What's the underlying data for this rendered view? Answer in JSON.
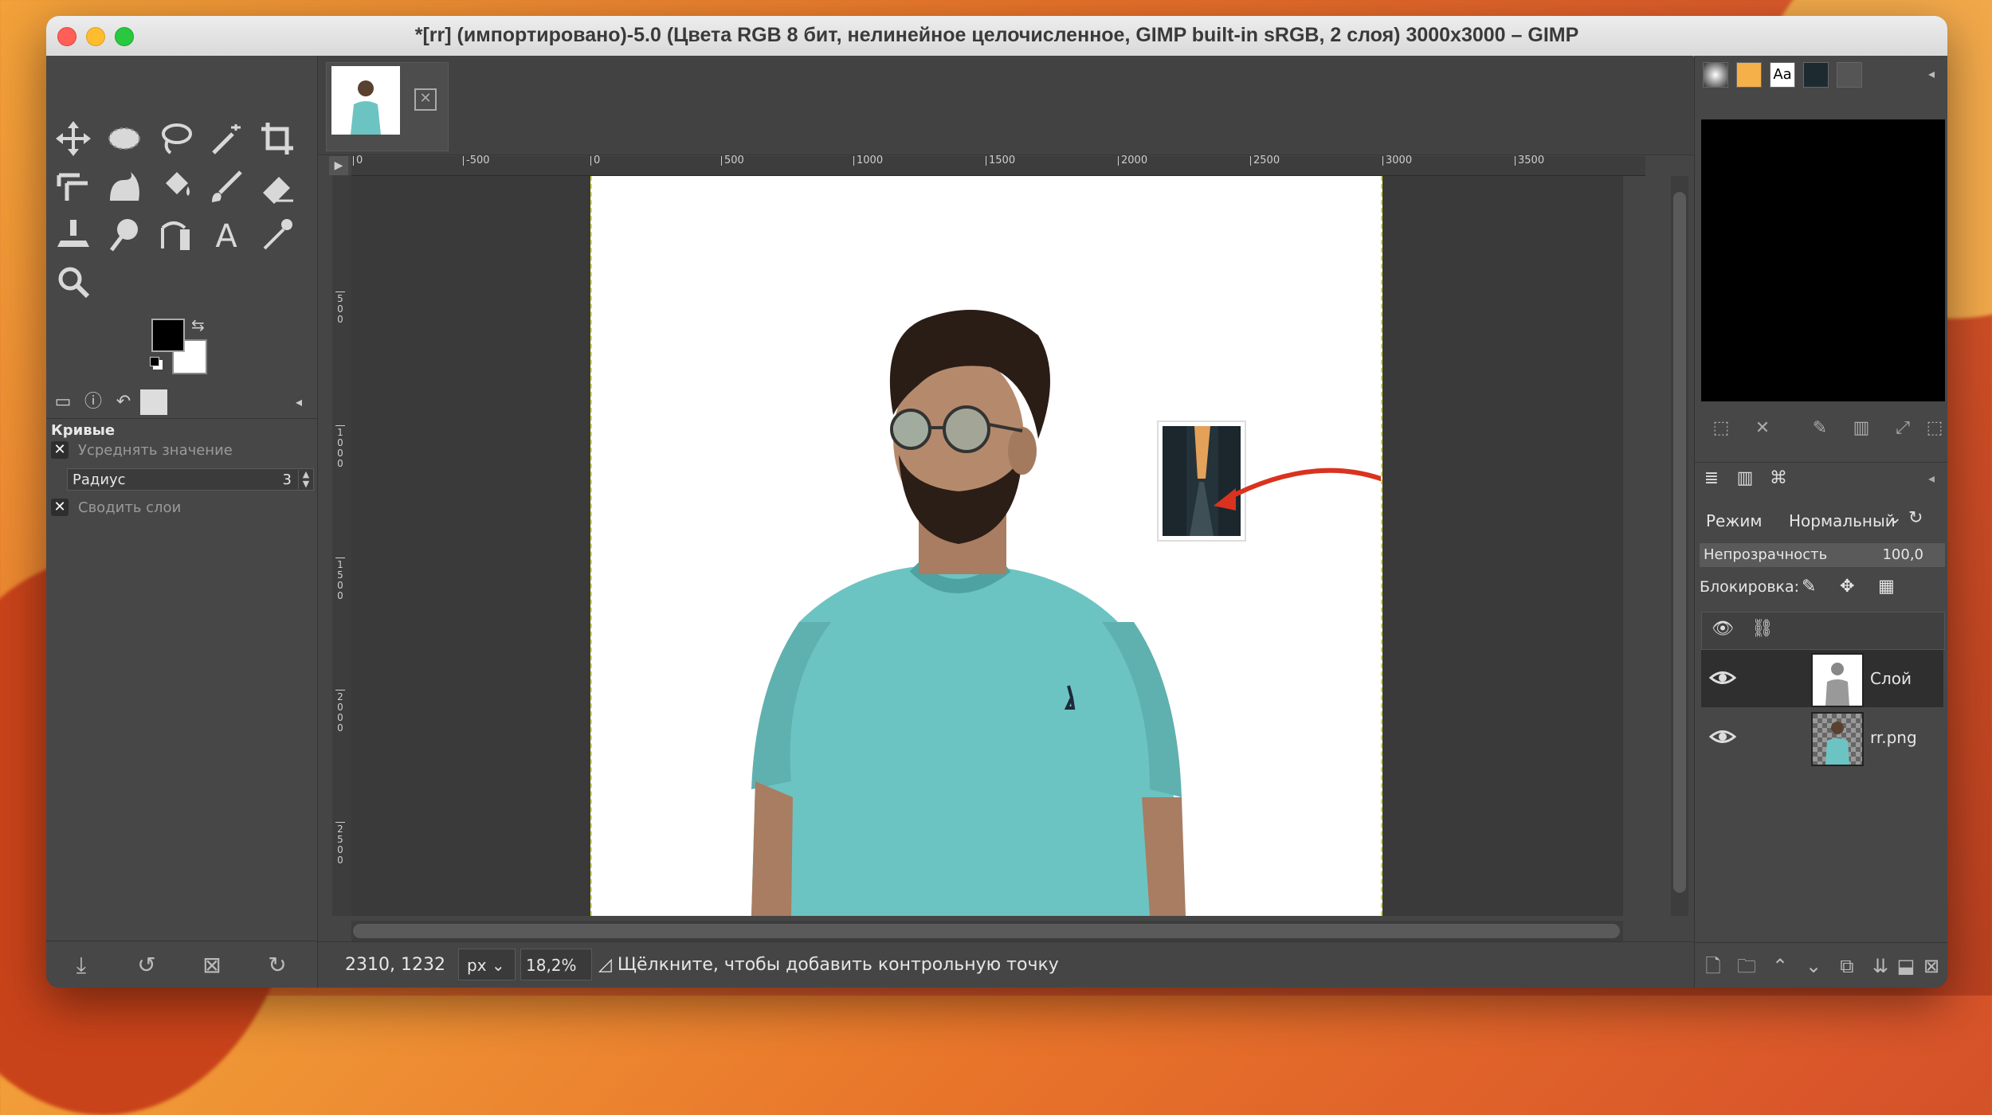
{
  "window": {
    "title": "*[rr] (импортировано)-5.0 (Цвета RGB 8 бит, нелинейное целочисленное, GIMP built-in sRGB, 2 слоя) 3000x3000 – GIMP"
  },
  "toolbox": {
    "tools": [
      "move-tool",
      "ellipse-select-tool",
      "free-select-tool",
      "fuzzy-select-tool",
      "crop-tool",
      "unified-transform-tool",
      "warp-transform-tool",
      "bucket-fill-tool",
      "paintbrush-tool",
      "eraser-tool",
      "clone-tool",
      "smudge-tool",
      "paths-tool",
      "text-tool",
      "color-picker-tool",
      "zoom-tool"
    ],
    "fg_color": "#000000",
    "bg_color": "#ffffff"
  },
  "tool_options": {
    "title": "Кривые",
    "sample_average_label": "Усреднять значение",
    "radius_label": "Радиус",
    "radius_value": "3",
    "sample_merged_label": "Сводить слои"
  },
  "canvas": {
    "ruler_labels": [
      "0",
      "-500",
      "0",
      "500",
      "1000",
      "1500",
      "2000",
      "2500",
      "3000",
      "3500"
    ],
    "vruler_labels": [
      "5\n0\n0",
      "1\n0\n0\n0",
      "1\n5\n0\n0",
      "2\n0\n0\n0",
      "2\n5\n0\n0"
    ]
  },
  "status": {
    "coords": "2310, 1232",
    "unit": "px",
    "zoom": "18,2%",
    "hint": "Щёлкните, чтобы добавить контрольную точку"
  },
  "layers_panel": {
    "mode_label": "Режим",
    "mode_value": "Нормальный",
    "opacity_label": "Непрозрачность",
    "opacity_value": "100,0",
    "opacity_fraction": 1.0,
    "lock_label": "Блокировка:",
    "layers": [
      {
        "name": "Слой",
        "visible": true,
        "selected": true
      },
      {
        "name": "rr.png",
        "visible": true,
        "selected": false
      }
    ]
  },
  "colors": {
    "accent_red": "#d9331f",
    "guide_yellow": "#d7e21d",
    "shirt": "#6cc4c2"
  }
}
